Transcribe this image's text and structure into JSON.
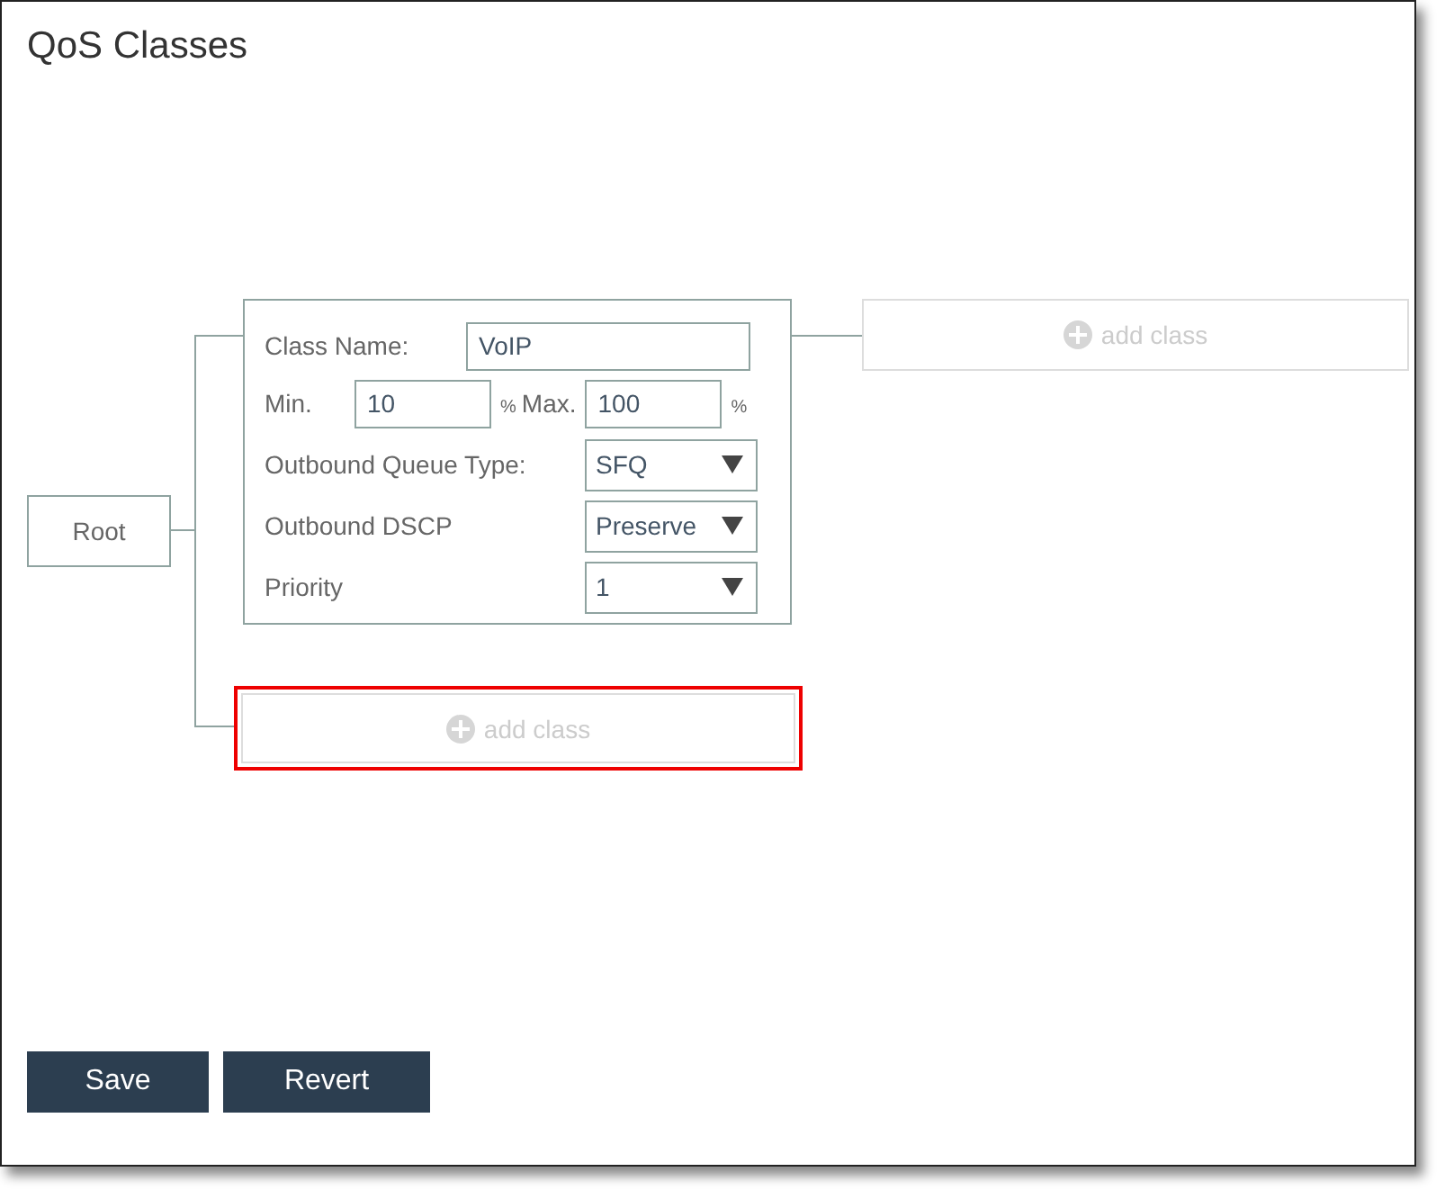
{
  "panel": {
    "title": "QoS Classes"
  },
  "tree": {
    "root": {
      "label": "Root"
    },
    "class_node": {
      "fields": [
        {
          "kind": "text",
          "label": "Class Name:",
          "value": "VoIP"
        },
        {
          "kind": "range",
          "label": "Min.",
          "value": "10",
          "unit": "%",
          "label_2": "Max.",
          "value_2": "100",
          "unit_2": "%"
        },
        {
          "kind": "select",
          "label": "Outbound Queue Type:",
          "value": "SFQ"
        },
        {
          "kind": "select",
          "label": "Outbound DSCP",
          "value": "Preserve"
        },
        {
          "kind": "select",
          "label": "Priority",
          "value": "1"
        }
      ]
    },
    "add_class": [
      {
        "label": "add class",
        "highlighted": false
      },
      {
        "label": "add class",
        "highlighted": true
      }
    ]
  },
  "buttons": [
    {
      "label": "Save"
    },
    {
      "label": "Revert"
    }
  ]
}
